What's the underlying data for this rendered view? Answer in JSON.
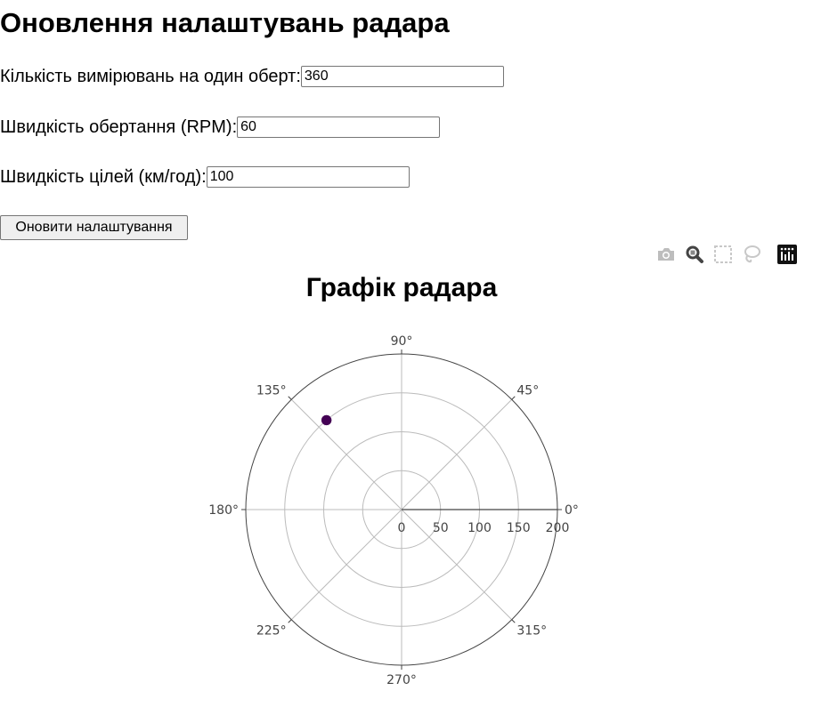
{
  "page_title": "Оновлення налаштувань радара",
  "form": {
    "measurements_label": "Кількість вимірювань на один оберт:",
    "measurements_value": "360",
    "rpm_label": "Швидкість обертання (RPM):",
    "rpm_value": "60",
    "target_speed_label": "Швидкість цілей (км/год):",
    "target_speed_value": "100",
    "update_button_label": "Оновити налаштування"
  },
  "modebar": {
    "icons": [
      "camera-icon",
      "zoom-icon",
      "box-select-icon",
      "lasso-select-icon",
      "plotly-logo-icon"
    ]
  },
  "chart_data": {
    "type": "scatter",
    "projection": "polar",
    "title": "Графік радара",
    "radial_axis": {
      "range": [
        0,
        200
      ],
      "tick_labels": [
        "0",
        "50",
        "100",
        "150",
        "200"
      ]
    },
    "angular_axis": {
      "units": "degrees",
      "tick_labels": [
        "0°",
        "45°",
        "90°",
        "135°",
        "180°",
        "225°",
        "270°",
        "315°"
      ]
    },
    "grid": true,
    "series": [
      {
        "points": [
          {
            "r": 150,
            "theta": 130
          }
        ],
        "marker_color": "#440154"
      }
    ]
  }
}
